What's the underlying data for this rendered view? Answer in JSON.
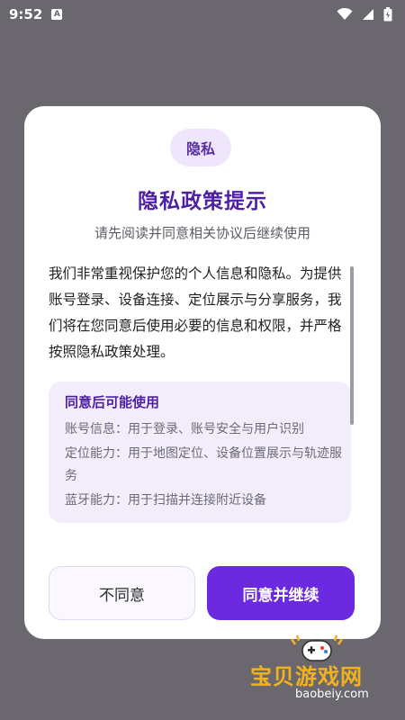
{
  "status_bar": {
    "time": "9:52",
    "a_glyph": "A"
  },
  "icons": {
    "wifi": "wifi-icon",
    "signal": "signal-icon",
    "battery": "battery-icon",
    "notification": "notification-a-icon"
  },
  "dialog": {
    "badge": "隐私",
    "title": "隐私政策提示",
    "subtitle": "请先阅读并同意相关协议后继续使用",
    "intro": "我们非常重视保护您的个人信息和隐私。为提供账号登录、设备连接、定位展示与分享服务，我们将在您同意后使用必要的信息和权限，并严格按照隐私政策处理。",
    "usage": {
      "title": "同意后可能使用",
      "items": [
        "账号信息：用于登录、账号安全与用户识别",
        "定位能力：用于地图定位、设备位置展示与轨迹服务",
        "蓝牙能力：用于扫描并连接附近设备"
      ]
    },
    "buttons": {
      "disagree": "不同意",
      "agree": "同意并继续"
    }
  },
  "watermark": {
    "text": "宝贝游戏网",
    "url": "baobeiy.com"
  },
  "colors": {
    "accent": "#6c2ae0",
    "title": "#4f1fa3",
    "overlay": "#6a686e",
    "usage_bg": "#f3edfb"
  }
}
